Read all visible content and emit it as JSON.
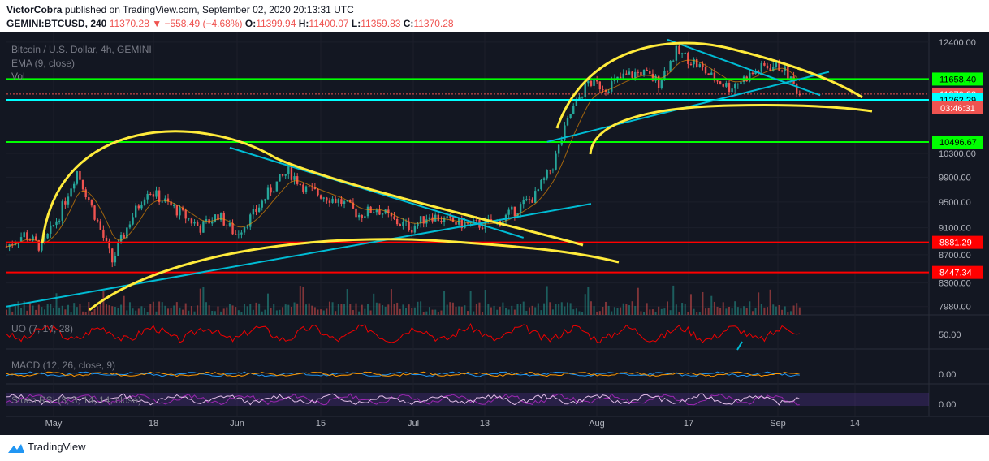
{
  "header": {
    "author": "VictorCobra",
    "published_text": "published on TradingView.com, September 02, 2020 20:13:31 UTC",
    "symbol": "GEMINI:BTCUSD, 240",
    "last_price": "11370.28",
    "change": "−558.49 (−4.68%)",
    "o_label": "O:",
    "o_value": "11399.94",
    "h_label": "H:",
    "h_value": "11400.07",
    "l_label": "L:",
    "l_value": "11359.83",
    "c_label": "C:",
    "c_value": "11370.28"
  },
  "legend": {
    "title": "Bitcoin / U.S. Dollar, 4h, GEMINI",
    "ema": "EMA (9, close)",
    "vol": "Vol",
    "uo": "UO (7, 14, 28)",
    "macd": "MACD (12, 26, close, 9)",
    "stoch": "Stoch RSI (3, 3, 14, 14, close)"
  },
  "footer": {
    "brand": "TradingView"
  },
  "colors": {
    "background": "#131722",
    "up": "#26a69a",
    "down": "#ef5350",
    "green_level": "#00ff00",
    "red_level": "#ff0000",
    "cyan_line": "#00bcd4",
    "yellow_curve": "#ffeb3b"
  },
  "chart_data": {
    "type": "candlestick",
    "title": "Bitcoin / U.S. Dollar, 4h, GEMINI",
    "x_ticks": [
      "May",
      "18",
      "Jun",
      "15",
      "Jul",
      "13",
      "Aug",
      "17",
      "Sep",
      "14"
    ],
    "y_ticks": [
      12400.0,
      10300.0,
      9900.0,
      9500.0,
      9100.0,
      8700.0,
      8300.0,
      7980.0
    ],
    "y_range": [
      7870,
      12600
    ],
    "y_scale": "log",
    "horizontal_levels": [
      {
        "value": 11658.4,
        "label": "11658.40",
        "color": "#00ff00"
      },
      {
        "value": 11370.28,
        "label": "11370.28",
        "color": "#ef5350",
        "dotted": true
      },
      {
        "value": 11262.29,
        "label": "11262.29",
        "color": "#00ffff"
      },
      {
        "value": 10496.67,
        "label": "10496.67",
        "color": "#00ff00"
      },
      {
        "value": 8881.29,
        "label": "8881.29",
        "color": "#ff0000"
      },
      {
        "value": 8447.34,
        "label": "8447.34",
        "color": "#ff0000"
      }
    ],
    "countdown": "03:46:31",
    "price_path": [
      {
        "t": 0,
        "p": 8820
      },
      {
        "t": 6,
        "p": 9000
      },
      {
        "t": 12,
        "p": 8800
      },
      {
        "t": 18,
        "p": 9300
      },
      {
        "t": 24,
        "p": 10000
      },
      {
        "t": 30,
        "p": 9300
      },
      {
        "t": 36,
        "p": 8600
      },
      {
        "t": 42,
        "p": 9200
      },
      {
        "t": 48,
        "p": 9700
      },
      {
        "t": 54,
        "p": 9500
      },
      {
        "t": 60,
        "p": 9300
      },
      {
        "t": 66,
        "p": 9100
      },
      {
        "t": 72,
        "p": 9300
      },
      {
        "t": 78,
        "p": 9000
      },
      {
        "t": 84,
        "p": 9300
      },
      {
        "t": 90,
        "p": 9700
      },
      {
        "t": 96,
        "p": 10000
      },
      {
        "t": 102,
        "p": 9700
      },
      {
        "t": 108,
        "p": 9600
      },
      {
        "t": 114,
        "p": 9500
      },
      {
        "t": 120,
        "p": 9300
      },
      {
        "t": 126,
        "p": 9400
      },
      {
        "t": 132,
        "p": 9200
      },
      {
        "t": 138,
        "p": 9100
      },
      {
        "t": 144,
        "p": 9300
      },
      {
        "t": 150,
        "p": 9200
      },
      {
        "t": 156,
        "p": 9150
      },
      {
        "t": 162,
        "p": 9150
      },
      {
        "t": 168,
        "p": 9200
      },
      {
        "t": 174,
        "p": 9400
      },
      {
        "t": 180,
        "p": 9600
      },
      {
        "t": 186,
        "p": 10100
      },
      {
        "t": 192,
        "p": 11000
      },
      {
        "t": 198,
        "p": 11600
      },
      {
        "t": 204,
        "p": 11500
      },
      {
        "t": 210,
        "p": 11700
      },
      {
        "t": 216,
        "p": 11800
      },
      {
        "t": 222,
        "p": 11600
      },
      {
        "t": 228,
        "p": 12200
      },
      {
        "t": 234,
        "p": 12000
      },
      {
        "t": 240,
        "p": 11700
      },
      {
        "t": 246,
        "p": 11500
      },
      {
        "t": 252,
        "p": 11700
      },
      {
        "t": 258,
        "p": 11900
      },
      {
        "t": 264,
        "p": 11900
      },
      {
        "t": 270,
        "p": 11370
      }
    ],
    "annotations": {
      "cyan_trendlines": [
        [
          {
            "t": 0,
            "p": 7980
          },
          {
            "t": 199,
            "p": 9470
          }
        ],
        [
          {
            "t": 76,
            "p": 10400
          },
          {
            "t": 176,
            "p": 8950
          }
        ],
        [
          {
            "t": 184,
            "p": 10500
          },
          {
            "t": 280,
            "p": 11800
          }
        ],
        [
          {
            "t": 225,
            "p": 12450
          },
          {
            "t": 277,
            "p": 11350
          }
        ]
      ],
      "yellow_arcs": [
        "lower-left arch",
        "lower bowl",
        "upper-right arch",
        "upper bowl"
      ]
    },
    "indicators": {
      "uo": {
        "label": "UO (7, 14, 28)",
        "ticks": [
          50.0
        ]
      },
      "macd": {
        "label": "MACD (12, 26, close, 9)",
        "ticks": [
          0.0
        ]
      },
      "stoch_rsi": {
        "label": "Stoch RSI (3, 3, 14, 14, close)",
        "ticks": [
          0.0
        ]
      }
    }
  }
}
